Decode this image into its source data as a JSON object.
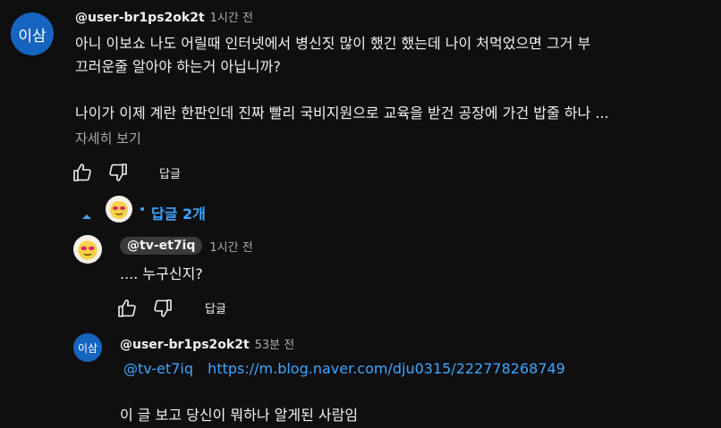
{
  "comment": {
    "avatar_text": "이삼",
    "author": "@user-br1ps2ok2t",
    "time": "1시간 전",
    "lines": [
      "아니 이보쇼 나도 어릴때 인터넷에서 병신짓 많이 했긴 했는데 나이 처먹었으면 그거 부",
      "끄러운줄 알아야 하는거 아닙니까?",
      "나이가 이제 계란 한판인데 진짜 빨리 국비지원으로 교육을 받건 공장에 가건 밥줄 하나 ..."
    ],
    "read_more": "자세히 보기",
    "reply_label": "답글"
  },
  "replies_toggle": {
    "dot": "•",
    "label": "답글 2개"
  },
  "reply1": {
    "author": "@tv-et7iq",
    "time": "1시간 전",
    "text": ".... 누구신지?",
    "reply_label": "답글"
  },
  "reply2": {
    "avatar_text": "이삼",
    "author": "@user-br1ps2ok2t",
    "time": "53분 전",
    "mention": "@tv-et7iq",
    "url": "https://m.blog.naver.com/dju0315/222778268749",
    "text": "이 글 보고 당신이 뭐하나 알게된 사람임"
  },
  "icons": {
    "like": "thumbs-up-icon",
    "dislike": "thumbs-down-icon",
    "collapse": "caret-up-icon"
  },
  "colors": {
    "background": "#0f0f0f",
    "link": "#3ea6ff",
    "avatar_blue": "#1565c0",
    "chip": "#3a3a3a"
  }
}
